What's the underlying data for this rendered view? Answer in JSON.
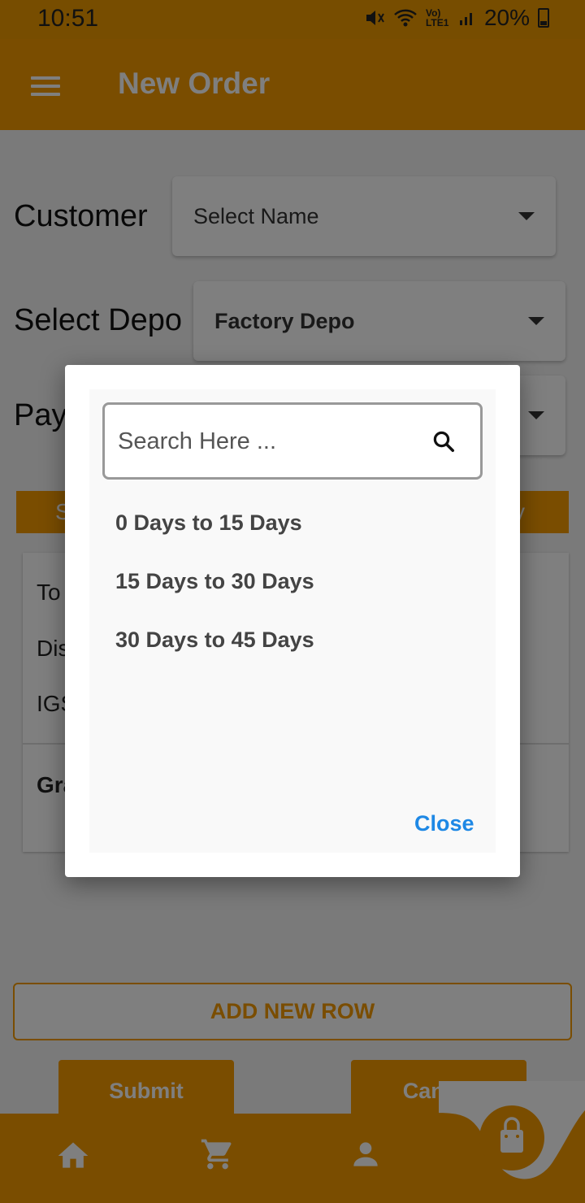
{
  "status_bar": {
    "time": "10:51",
    "signal_label": "Vo) LTE1",
    "battery": "20%"
  },
  "app_bar": {
    "title": "New Order"
  },
  "form": {
    "customer_label": "Customer",
    "customer_value": "Select Name",
    "depo_label": "Select Depo",
    "depo_value": "Factory Depo",
    "payment_label_partial": "Pay"
  },
  "table_header": {
    "left_partial": "S",
    "right_partial": "y"
  },
  "summary": {
    "total_partial": "To",
    "discount_partial": "Dis",
    "igst_partial": "IGS",
    "grand_partial": "Gra"
  },
  "buttons": {
    "add_row": "ADD NEW ROW",
    "submit": "Submit",
    "cancel": "Cancel"
  },
  "dialog": {
    "search_placeholder": "Search Here ...",
    "options": [
      "0 Days to 15 Days",
      "15 Days to 30 Days",
      "30 Days to 45 Days"
    ],
    "close": "Close"
  },
  "bottom_nav": {
    "items": [
      "home-icon",
      "cart-icon",
      "person-icon",
      "shopping-bag-icon"
    ]
  },
  "colors": {
    "primary": "#f59a00",
    "link": "#1e88e5"
  }
}
